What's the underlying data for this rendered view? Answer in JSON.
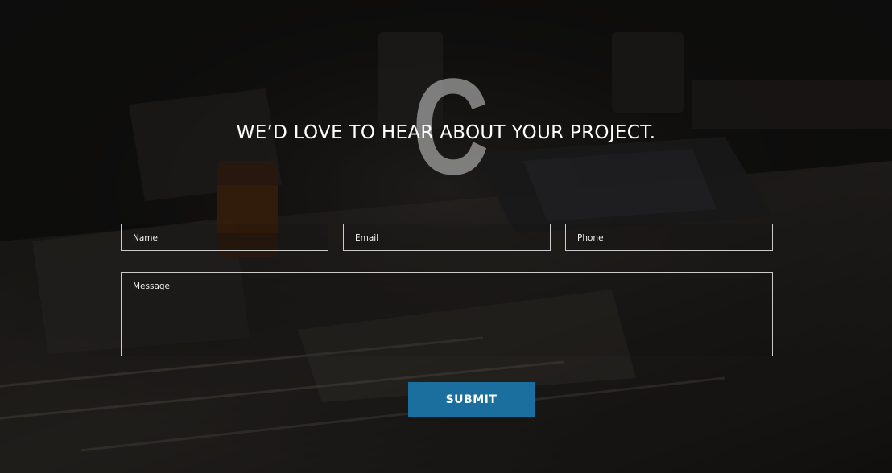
{
  "page": {
    "logo_letter": "C",
    "headline": "WE’D LOVE TO HEAR ABOUT YOUR PROJECT."
  },
  "form": {
    "name_placeholder": "Name",
    "email_placeholder": "Email",
    "phone_placeholder": "Phone",
    "message_placeholder": "Message",
    "submit_label": "SUBMIT"
  },
  "colors": {
    "accent": "#1a6f9e",
    "overlay": "#141414"
  }
}
